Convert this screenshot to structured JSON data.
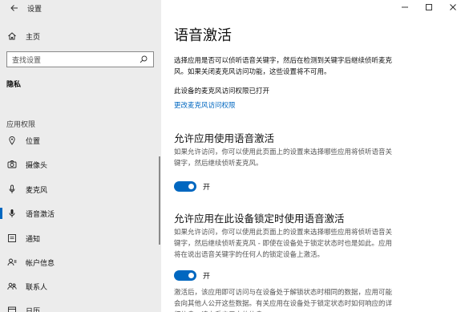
{
  "window": {
    "title": "设置"
  },
  "sidebar": {
    "home_label": "主页",
    "search_placeholder": "查找设置",
    "section_heading": "隐私",
    "group_heading": "应用权限",
    "items": [
      {
        "label": "位置",
        "icon": "location-icon",
        "active": false
      },
      {
        "label": "摄像头",
        "icon": "camera-icon",
        "active": false
      },
      {
        "label": "麦克风",
        "icon": "microphone-icon",
        "active": false
      },
      {
        "label": "语音激活",
        "icon": "voice-activation-icon",
        "active": true
      },
      {
        "label": "通知",
        "icon": "notification-icon",
        "active": false
      },
      {
        "label": "帐户信息",
        "icon": "account-info-icon",
        "active": false
      },
      {
        "label": "联系人",
        "icon": "contacts-icon",
        "active": false
      },
      {
        "label": "日历",
        "icon": "calendar-icon",
        "active": false
      }
    ]
  },
  "main": {
    "title": "语音激活",
    "intro": "选择应用是否可以侦听语音关键字，然后在检测到关键字后继续侦听麦克风。如果关闭麦克风访问功能，这些设置将不可用。",
    "mic_status": "此设备的麦克风访问权限已打开",
    "change_link": "更改麦克风访问权限",
    "section1": {
      "heading": "允许应用使用语音激活",
      "description": "如果允许访问，你可以使用此页面上的设置来选择哪些应用将侦听语音关键字，然后继续侦听麦克风。",
      "toggle_label": "开",
      "toggle_on": true
    },
    "section2": {
      "heading": "允许应用在此设备锁定时使用语音激活",
      "description": "如果允许访问，你可以使用此页面上的设置来选择哪些应用将侦听语音关键字，然后继续侦听麦克风 - 即使在设备处于锁定状态时也是如此。应用将在说出语音关键字的任何人的锁定设备上激活。",
      "toggle_label": "开",
      "toggle_on": true
    },
    "footer_text": "激活后，该应用即可访问与在设备处于解锁状态时相同的数据，应用可能会向其他人公开这些数据。有关应用在设备处于锁定状态时如何响应的详细信息，请查看应用中的信息。"
  },
  "colors": {
    "accent": "#0067c0",
    "sidebar_bg": "#ececec"
  }
}
